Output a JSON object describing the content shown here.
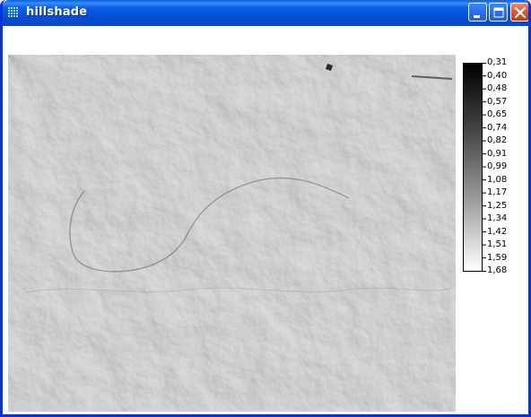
{
  "window": {
    "title": "hillshade",
    "icon": "grid-app-icon",
    "controls": [
      "minimize-icon",
      "maximize-icon",
      "close-icon"
    ]
  },
  "map": {
    "description_icon": "hillshade-raster"
  },
  "legend": {
    "labels": [
      "0,31",
      "0,40",
      "0,48",
      "0,57",
      "0,65",
      "0,74",
      "0,82",
      "0,91",
      "0,99",
      "1,08",
      "1,17",
      "1,25",
      "1,34",
      "1,42",
      "1,51",
      "1,59",
      "1,68"
    ],
    "gradient_top": "#000000",
    "gradient_bottom": "#ffffff"
  },
  "colors": {
    "titlebar": "#0a5de6",
    "frame": "#0831d9",
    "close_button": "#e0542c"
  }
}
